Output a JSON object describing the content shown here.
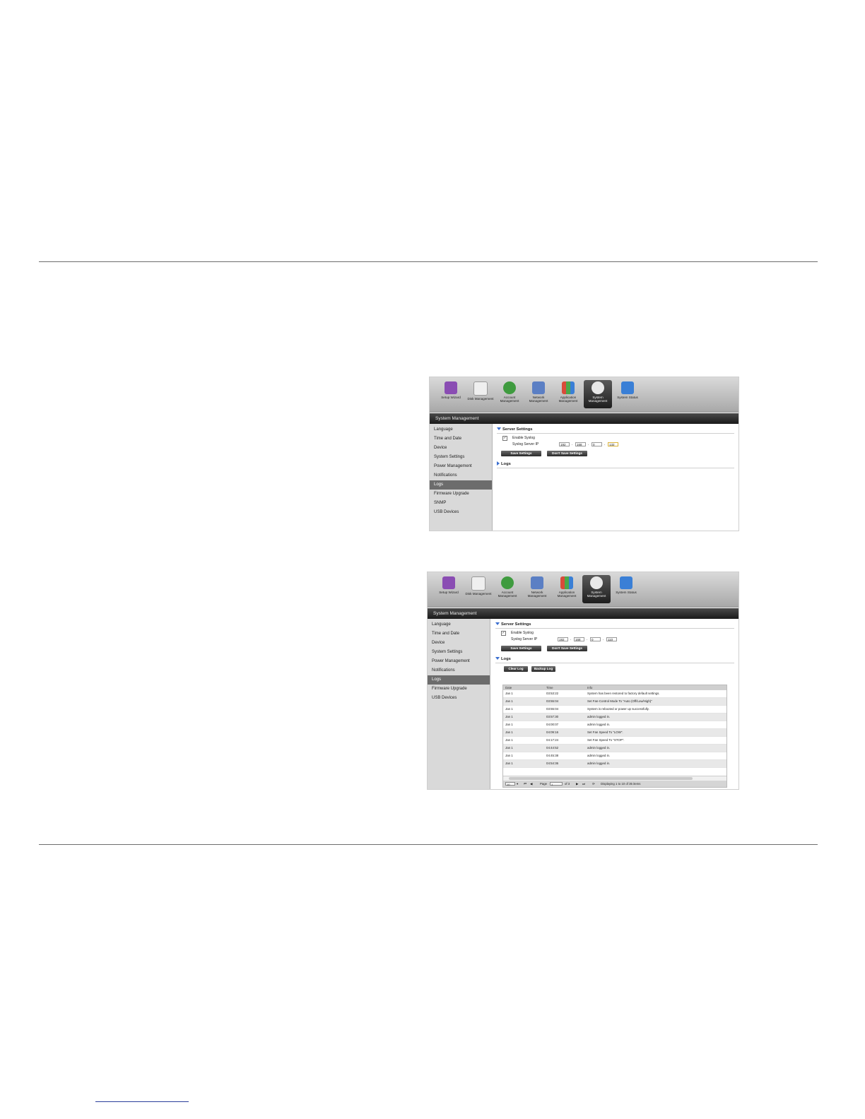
{
  "toolbar": {
    "items": [
      {
        "label": "Setup Wizard",
        "icon": "wizard-icon",
        "color": "#8a4db3"
      },
      {
        "label": "Disk Management",
        "icon": "disk-icon",
        "color": "#d9d9d9"
      },
      {
        "label": "Account Management",
        "icon": "account-icon",
        "color": "#3f9b3f"
      },
      {
        "label": "Network Management",
        "icon": "network-icon",
        "color": "#5b7fc4"
      },
      {
        "label": "Application Management",
        "icon": "application-icon",
        "color": "#d49a3a"
      },
      {
        "label": "System Management",
        "icon": "system-gear-icon",
        "color": "#e8e8e8"
      },
      {
        "label": "System Status",
        "icon": "info-icon",
        "color": "#3a7fd6"
      }
    ]
  },
  "panel_title": "System Management",
  "sidebar1": [
    "Language",
    "Time and Date",
    "Device",
    "System Settings",
    "Power Management",
    "Notifications",
    "Logs",
    "Firmware Upgrade",
    "SNMP",
    "USB Devices"
  ],
  "sidebar2": [
    "Language",
    "Time and Date",
    "Device",
    "System Settings",
    "Power Management",
    "Notifications",
    "Logs",
    "Firmware Upgrade",
    "USB Devices"
  ],
  "server_settings": {
    "title": "Server Settings",
    "enable_label": "Enable Syslog",
    "ip_label": "Syslog Server IP",
    "ip1": [
      "192",
      "168",
      "0",
      "132"
    ],
    "ip2": [
      "192",
      "168",
      "0",
      "110"
    ],
    "save_label": "Save Settings",
    "dont_save_label": "Don't Save Settings"
  },
  "logs": {
    "title": "Logs",
    "clear_label": "Clear Log",
    "backup_label": "Backup Log",
    "columns": [
      "Date",
      "Time",
      "Info"
    ],
    "rows": [
      [
        "Jan 1",
        "03:53:22",
        "System has been restored to factory default settings."
      ],
      [
        "Jan 1",
        "03:55:04",
        "Set Fan-Control Mode To \"Auto (Off/Low/High)\""
      ],
      [
        "Jan 1",
        "03:55:04",
        "System is rebooted or power up successfully."
      ],
      [
        "Jan 1",
        "03:57:30",
        "admin logged in."
      ],
      [
        "Jan 1",
        "04:00:07",
        "admin logged in."
      ],
      [
        "Jan 1",
        "04:09:16",
        "Set Fan Speed To \"LOW\"."
      ],
      [
        "Jan 1",
        "04:17:24",
        "Set Fan Speed To \"STOP\"."
      ],
      [
        "Jan 1",
        "04:44:52",
        "admin logged in."
      ],
      [
        "Jan 1",
        "04:45:38",
        "admin logged in."
      ],
      [
        "Jan 1",
        "04:54:36",
        "admin logged in."
      ]
    ],
    "pager": {
      "per_page": "10",
      "page_label": "Page",
      "page_value": "1",
      "of_label": "of 3",
      "display_text": "Displaying 1 to 10 of 35 items"
    }
  }
}
